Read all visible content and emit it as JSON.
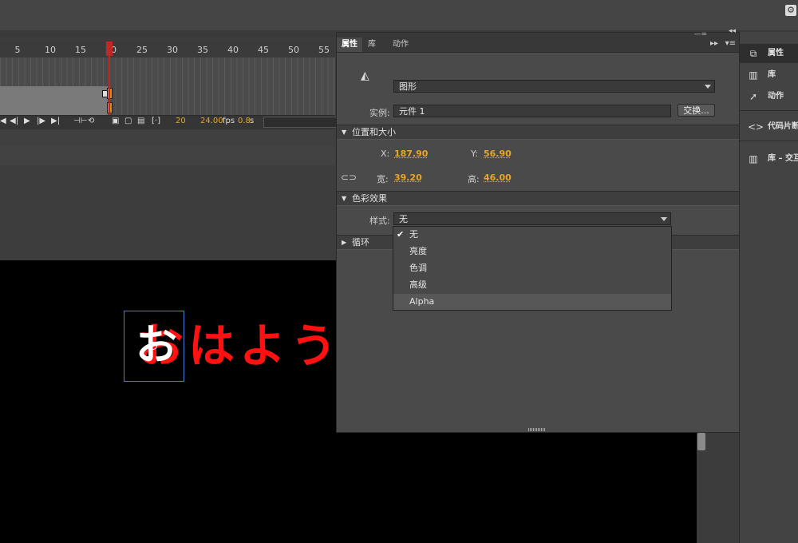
{
  "timeline": {
    "ruler_ticks": [
      "5",
      "10",
      "15",
      "20",
      "25",
      "30",
      "35",
      "40",
      "45",
      "50",
      "55"
    ],
    "current_frame": "20",
    "fps_value": "24.00",
    "fps_unit": "fps",
    "time_value": "0.8",
    "time_unit": "s"
  },
  "panel": {
    "tabs": [
      "属性",
      "库",
      "动作"
    ],
    "type_select": "图形",
    "instance_label": "实例:",
    "instance_value": "元件 1",
    "swap_button": "交换...",
    "section_position": "位置和大小",
    "x_label": "X:",
    "x_value": "187.90",
    "y_label": "Y:",
    "y_value": "56.90",
    "w_label": "宽:",
    "w_value": "39.20",
    "h_label": "高:",
    "h_value": "46.00",
    "section_color": "色彩效果",
    "style_label": "样式:",
    "style_value": "无",
    "section_loop": "循环",
    "style_options": [
      "无",
      "亮度",
      "色调",
      "高级",
      "Alpha"
    ],
    "selected_option": "无",
    "highlighted_option": "Alpha"
  },
  "stage": {
    "japanese_text": "おはよう"
  },
  "dock": {
    "items": [
      "属性",
      "库",
      "动作",
      "代码片断",
      "库 – 交互"
    ]
  },
  "colors": {
    "accent_value": "#e8a526",
    "stage_text": "#ff1111",
    "playhead": "#c02828"
  }
}
